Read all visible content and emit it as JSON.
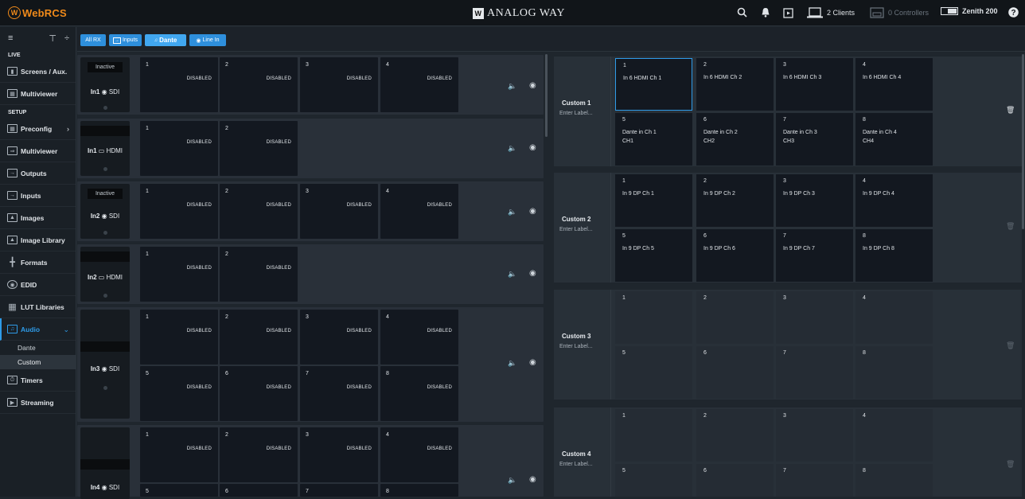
{
  "app": {
    "name": "WebRCS",
    "brand": "ANALOG WAY",
    "clients": "2 Clients",
    "controllers": "0 Controllers",
    "device": "Zenith 200"
  },
  "sidebar": {
    "live_label": "LIVE",
    "setup_label": "SETUP",
    "live_items": [
      "Screens / Aux.",
      "Multiviewer"
    ],
    "setup_items": [
      "Preconfig",
      "Multiviewer",
      "Outputs",
      "Inputs",
      "Images",
      "Image Library",
      "Formats",
      "EDID",
      "LUT Libraries",
      "Audio",
      "Timers",
      "Streaming"
    ],
    "audio_sub": [
      "Dante",
      "Custom"
    ],
    "active": "Audio",
    "selected_sub": "Custom"
  },
  "toolbar": {
    "chips": [
      "All RX",
      "Inputs",
      "Dante",
      "Line In"
    ],
    "selected": "Dante"
  },
  "sources": [
    {
      "status": "Inactive",
      "name": "In1",
      "type": "SDI",
      "channels": [
        "1",
        "2",
        "3",
        "4"
      ],
      "state": "DISABLED"
    },
    {
      "status": "",
      "name": "In1",
      "type": "HDMI",
      "channels": [
        "1",
        "2"
      ],
      "state": "DISABLED"
    },
    {
      "status": "Inactive",
      "name": "In2",
      "type": "SDI",
      "channels": [
        "1",
        "2",
        "3",
        "4"
      ],
      "state": "DISABLED"
    },
    {
      "status": "",
      "name": "In2",
      "type": "HDMI",
      "channels": [
        "1",
        "2"
      ],
      "state": "DISABLED"
    },
    {
      "status": "",
      "name": "In3",
      "type": "SDI",
      "channels": [
        "1",
        "2",
        "3",
        "4",
        "5",
        "6",
        "7",
        "8"
      ],
      "state": "DISABLED"
    },
    {
      "status": "",
      "name": "In4",
      "type": "SDI",
      "channels": [
        "1",
        "2",
        "3",
        "4",
        "5",
        "6",
        "7",
        "8"
      ],
      "state": "DISABLED"
    }
  ],
  "customs": [
    {
      "name": "Custom 1",
      "placeholder": "Enter Label...",
      "channels": [
        {
          "n": "1",
          "label": "In 6 HDMI Ch 1"
        },
        {
          "n": "2",
          "label": "In 6 HDMI Ch 2"
        },
        {
          "n": "3",
          "label": "In 6 HDMI Ch 3"
        },
        {
          "n": "4",
          "label": "In 6 HDMI Ch 4"
        },
        {
          "n": "5",
          "label": "Dante in Ch 1",
          "label2": "CH1"
        },
        {
          "n": "6",
          "label": "Dante in Ch 2",
          "label2": "CH2"
        },
        {
          "n": "7",
          "label": "Dante in Ch 3",
          "label2": "CH3"
        },
        {
          "n": "8",
          "label": "Dante in Ch 4",
          "label2": "CH4"
        }
      ]
    },
    {
      "name": "Custom 2",
      "placeholder": "Enter Label...",
      "channels": [
        {
          "n": "1",
          "label": "In 9 DP Ch 1"
        },
        {
          "n": "2",
          "label": "In 9 DP Ch 2"
        },
        {
          "n": "3",
          "label": "In 9 DP Ch 3"
        },
        {
          "n": "4",
          "label": "In 9 DP Ch 4"
        },
        {
          "n": "5",
          "label": "In 9 DP Ch 5"
        },
        {
          "n": "6",
          "label": "In 9 DP Ch 6"
        },
        {
          "n": "7",
          "label": "In 9 DP Ch 7"
        },
        {
          "n": "8",
          "label": "In 9 DP Ch 8"
        }
      ]
    },
    {
      "name": "Custom 3",
      "placeholder": "Enter Label...",
      "channels": [
        {
          "n": "1"
        },
        {
          "n": "2"
        },
        {
          "n": "3"
        },
        {
          "n": "4"
        },
        {
          "n": "5"
        },
        {
          "n": "6"
        },
        {
          "n": "7"
        },
        {
          "n": "8"
        }
      ]
    },
    {
      "name": "Custom 4",
      "placeholder": "Enter Label...",
      "channels": [
        {
          "n": "1"
        },
        {
          "n": "2"
        },
        {
          "n": "3"
        },
        {
          "n": "4"
        },
        {
          "n": "5"
        },
        {
          "n": "6"
        },
        {
          "n": "7"
        },
        {
          "n": "8"
        }
      ]
    }
  ]
}
